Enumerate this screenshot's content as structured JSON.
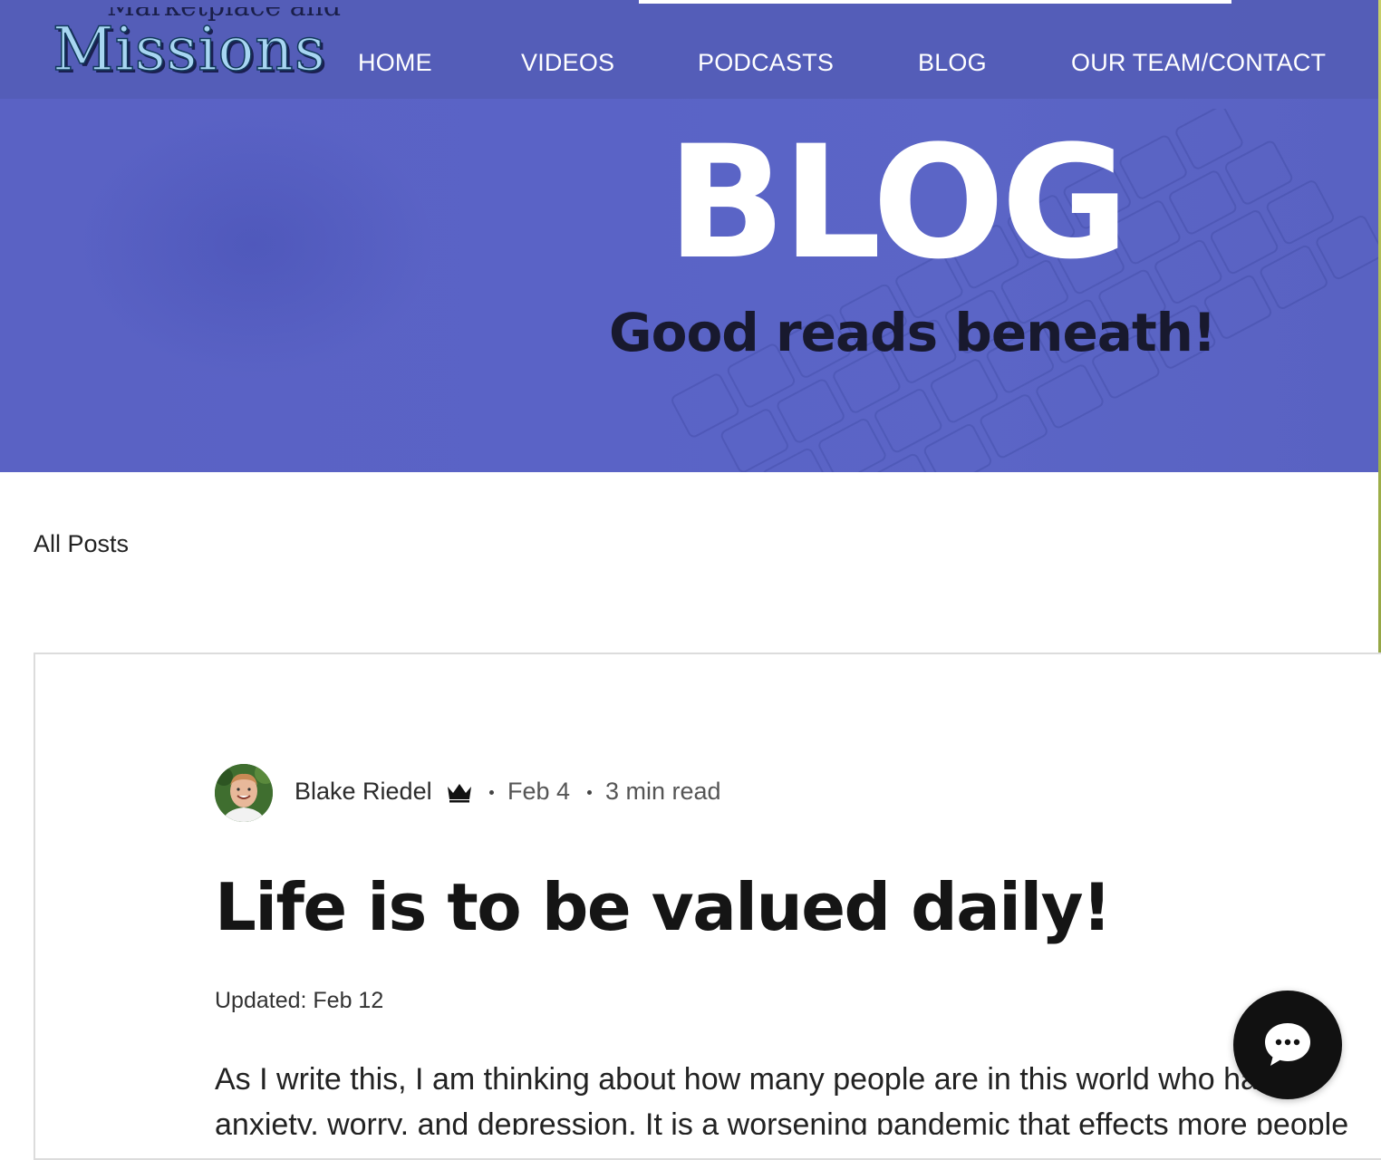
{
  "site": {
    "logo_text": "Missions",
    "logo_partial_text": "Marketplace and"
  },
  "nav": {
    "items": [
      {
        "label": "HOME"
      },
      {
        "label": "VIDEOS"
      },
      {
        "label": "PODCASTS"
      },
      {
        "label": "BLOG"
      },
      {
        "label": "OUR TEAM/CONTACT"
      }
    ]
  },
  "hero": {
    "title": "BLOG",
    "subtitle": "Good reads beneath!"
  },
  "filters": {
    "all_posts_label": "All Posts"
  },
  "post": {
    "author": "Blake Riedel",
    "author_badge_icon": "crown-icon",
    "date": "Feb 4",
    "read_time": "3 min read",
    "title": "Life is to be valued daily!",
    "updated": "Updated: Feb 12",
    "body_lines": [
      "As I write this, I am thinking about how many people are in this world who have",
      "anxiety, worry, and depression. It is a worsening pandemic that effects more people"
    ]
  },
  "chat": {
    "icon": "chat-bubble-icon"
  },
  "colors": {
    "hero_bg": "#5a63c6",
    "nav_bg": "#545cb6",
    "text_dark": "#151515",
    "chat_bg": "#111111"
  }
}
